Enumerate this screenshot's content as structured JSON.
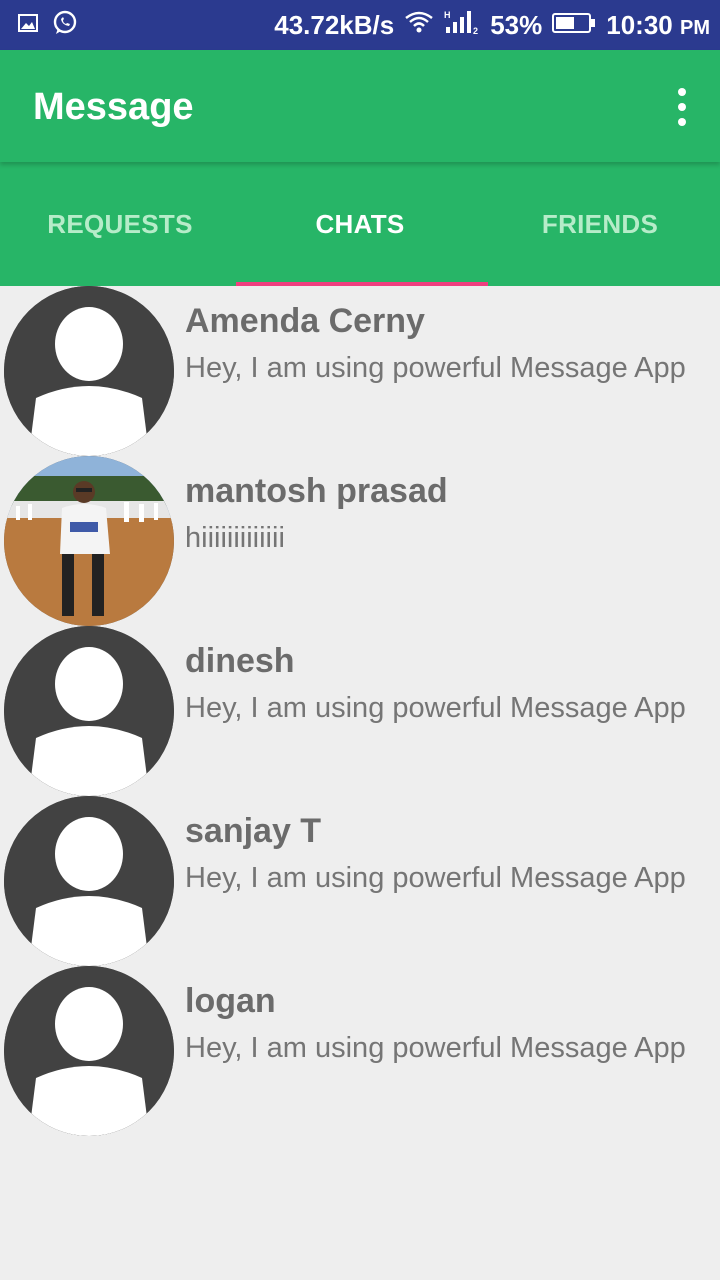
{
  "status_bar": {
    "speed": "43.72kB/s",
    "battery": "53%",
    "time": "10:30",
    "ampm": "PM",
    "icons": [
      "image-icon",
      "whatsapp-icon",
      "wifi-icon",
      "signal-icon",
      "battery-icon"
    ]
  },
  "app_bar": {
    "title": "Message"
  },
  "tabs": [
    {
      "label": "REQUESTS",
      "active": false
    },
    {
      "label": "CHATS",
      "active": true
    },
    {
      "label": "FRIENDS",
      "active": false
    }
  ],
  "colors": {
    "status_bar": "#2b3a8f",
    "primary": "#27b567",
    "indicator": "#f03e7f",
    "background": "#eeeeee"
  },
  "chats": [
    {
      "name": "Amenda Cerny",
      "status": "Hey, I am using powerful Message App",
      "avatar": "default-avatar-icon"
    },
    {
      "name": "mantosh prasad",
      "status": "hiiiiiiiiiiiii",
      "avatar": "photo"
    },
    {
      "name": "dinesh",
      "status": "Hey, I am using powerful Message App",
      "avatar": "default-avatar-icon"
    },
    {
      "name": "sanjay T",
      "status": "Hey, I am using powerful Message App",
      "avatar": "default-avatar-icon"
    },
    {
      "name": "logan",
      "status": "Hey, I am using powerful Message App",
      "avatar": "default-avatar-icon"
    }
  ]
}
